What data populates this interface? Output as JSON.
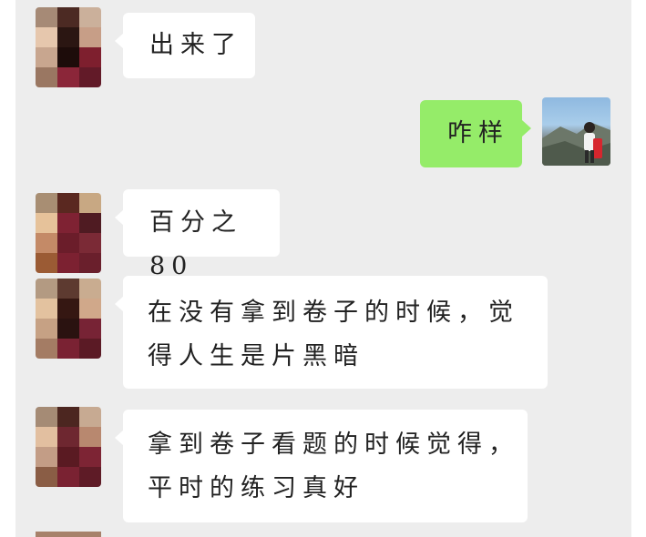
{
  "messages": [
    {
      "side": "left",
      "line1": "出来了",
      "line2": ""
    },
    {
      "side": "right",
      "line1": "咋样",
      "line2": ""
    },
    {
      "side": "left",
      "line1": "百分之80",
      "line2": ""
    },
    {
      "side": "left",
      "line1": "在没有拿到卷子的时候，觉",
      "line2": "得人生是片黑暗"
    },
    {
      "side": "left",
      "line1": "拿到卷子看题的时候觉得，",
      "line2": "平时的练习真好"
    }
  ],
  "colors": {
    "background": "#ededed",
    "incoming_bubble": "#ffffff",
    "outgoing_bubble": "#95ec69"
  }
}
